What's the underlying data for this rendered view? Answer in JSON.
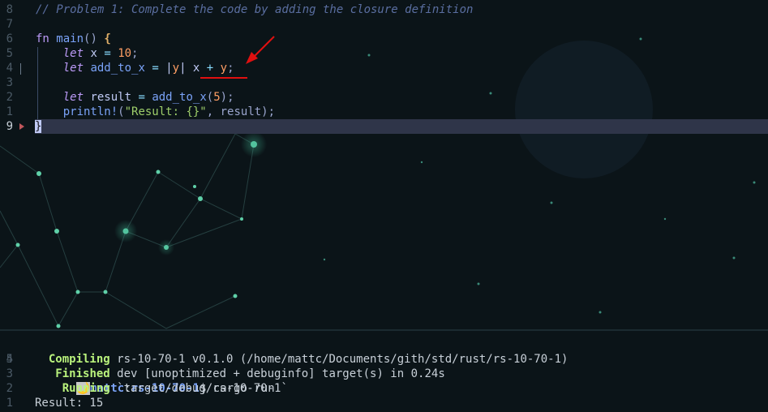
{
  "colors": {
    "background": "#0b1418",
    "current_line": "#2f3549",
    "annotation_red": "#e01010"
  },
  "editor": {
    "lines": [
      {
        "num": "8",
        "tokens": [
          {
            "t": "// Problem 1: Complete the code by adding the closure definition",
            "c": "cm"
          }
        ]
      },
      {
        "num": "7",
        "tokens": []
      },
      {
        "num": "6",
        "tokens": [
          {
            "t": "fn",
            "c": "kw"
          },
          {
            "t": " ",
            "c": ""
          },
          {
            "t": "main",
            "c": "fn"
          },
          {
            "t": "() ",
            "c": "pun"
          },
          {
            "t": "{",
            "c": "br"
          }
        ]
      },
      {
        "num": "5",
        "tokens": [
          {
            "t": "    ",
            "c": ""
          },
          {
            "t": "let",
            "c": "kwi"
          },
          {
            "t": " x ",
            "c": ""
          },
          {
            "t": "=",
            "c": "op"
          },
          {
            "t": " ",
            "c": ""
          },
          {
            "t": "10",
            "c": "num"
          },
          {
            "t": ";",
            "c": "pun"
          }
        ]
      },
      {
        "num": "4",
        "tokens": [
          {
            "t": "    ",
            "c": ""
          },
          {
            "t": "let",
            "c": "kwi"
          },
          {
            "t": " ",
            "c": ""
          },
          {
            "t": "add_to_x",
            "c": "fn"
          },
          {
            "t": " ",
            "c": ""
          },
          {
            "t": "=",
            "c": "op"
          },
          {
            "t": " |",
            "c": "pipe"
          },
          {
            "t": "y",
            "c": "num"
          },
          {
            "t": "|",
            "c": "pipe"
          },
          {
            "t": " x ",
            "c": ""
          },
          {
            "t": "+",
            "c": "op"
          },
          {
            "t": " ",
            "c": ""
          },
          {
            "t": "y",
            "c": "num"
          },
          {
            "t": ";",
            "c": "pun"
          }
        ]
      },
      {
        "num": "3",
        "tokens": []
      },
      {
        "num": "2",
        "tokens": [
          {
            "t": "    ",
            "c": ""
          },
          {
            "t": "let",
            "c": "kwi"
          },
          {
            "t": " result ",
            "c": ""
          },
          {
            "t": "=",
            "c": "op"
          },
          {
            "t": " ",
            "c": ""
          },
          {
            "t": "add_to_x",
            "c": "fn"
          },
          {
            "t": "(",
            "c": "pun"
          },
          {
            "t": "5",
            "c": "num"
          },
          {
            "t": ");",
            "c": "pun"
          }
        ]
      },
      {
        "num": "1",
        "tokens": [
          {
            "t": "    ",
            "c": ""
          },
          {
            "t": "println!",
            "c": "fn"
          },
          {
            "t": "(",
            "c": "pun"
          },
          {
            "t": "\"Result: {}\"",
            "c": "str"
          },
          {
            "t": ", result);",
            "c": "pun"
          }
        ]
      },
      {
        "num": "9",
        "tokens": [
          {
            "t": "}",
            "c": "cursor"
          }
        ]
      }
    ]
  },
  "terminal": {
    "prompt": {
      "num": "5",
      "icon": "🌙",
      "user": "mattc",
      "colon": ":",
      "dir": "rs-10-70-1",
      "symbol": "$",
      "command": " cargo run"
    },
    "output": [
      {
        "num": "4",
        "pad": "  ",
        "status": "Compiling",
        "text": " rs-10-70-1 v0.1.0 (/home/mattc/Documents/gith/std/rust/rs-10-70-1)"
      },
      {
        "num": "3",
        "pad": "   ",
        "status": "Finished",
        "text": " dev [unoptimized + debuginfo] target(s) in 0.24s"
      },
      {
        "num": "2",
        "pad": "    ",
        "status": "Running",
        "text": " `target/debug/rs-10-70-1`"
      },
      {
        "num": "1",
        "pad": "",
        "status": "",
        "text": "Result: 15"
      }
    ]
  }
}
